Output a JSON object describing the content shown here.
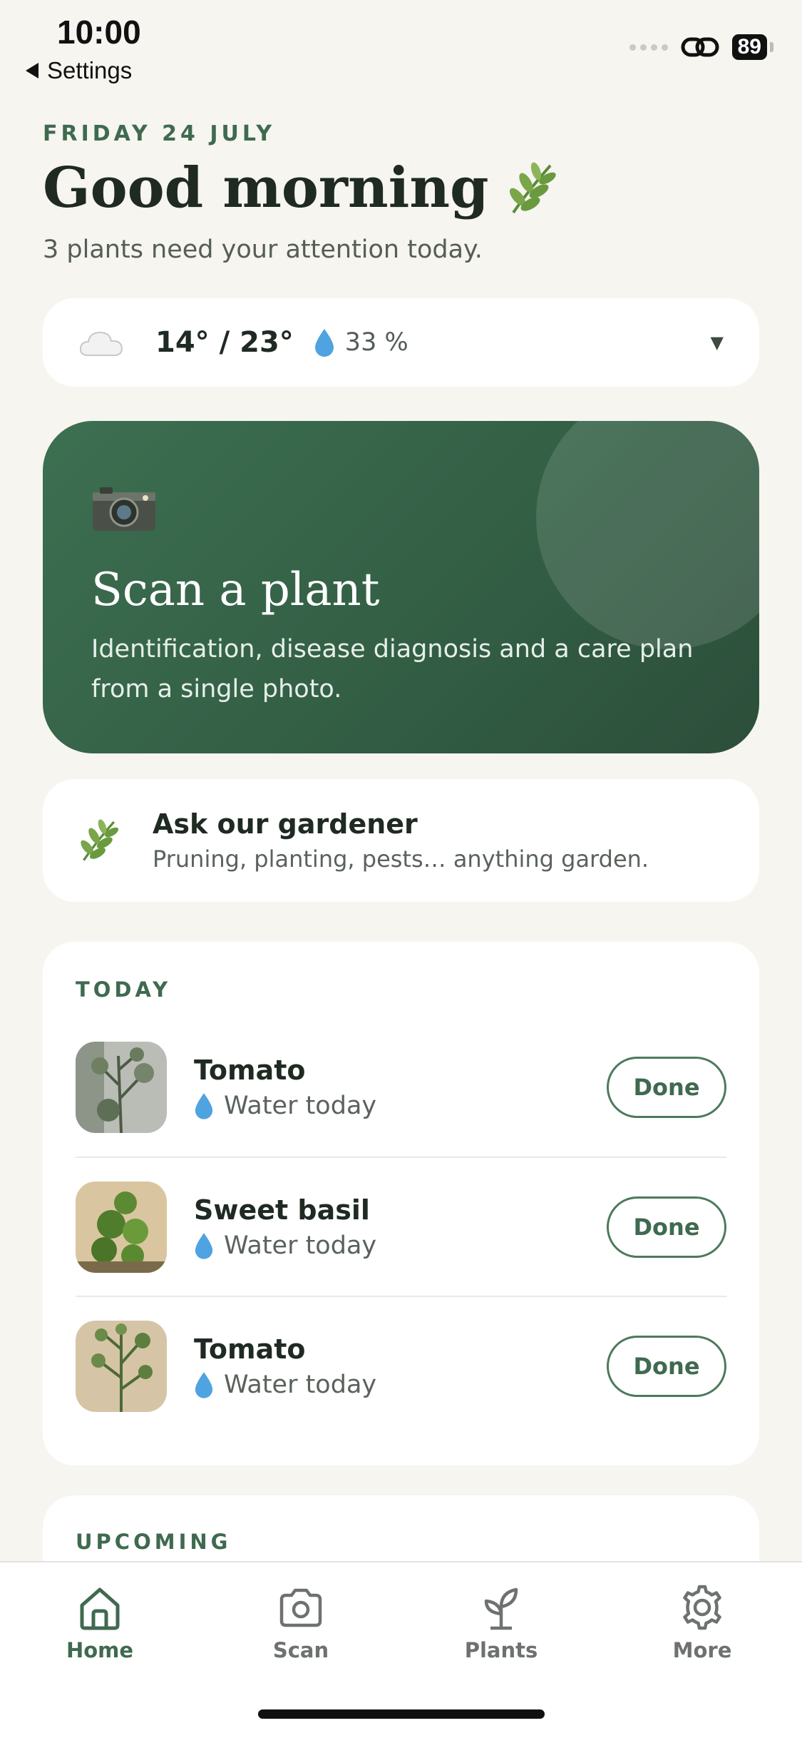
{
  "status_bar": {
    "time": "10:00",
    "back_label": "Settings",
    "battery": "89"
  },
  "header": {
    "date": "FRIDAY 24 JULY",
    "greeting": "Good morning",
    "subtitle": "3 plants need your attention today."
  },
  "weather": {
    "temperature": "14° / 23°",
    "humidity": "33 %",
    "icon": "cloud-icon"
  },
  "scan_card": {
    "title": "Scan a plant",
    "description": "Identification, disease diagnosis and a care plan from a single photo.",
    "icon": "camera-icon"
  },
  "gardener_card": {
    "title": "Ask our gardener",
    "description": "Pruning, planting, pests… anything garden.",
    "icon": "herb-icon"
  },
  "today": {
    "label": "TODAY",
    "tasks": [
      {
        "name": "Tomato",
        "task": "Water today",
        "button": "Done"
      },
      {
        "name": "Sweet basil",
        "task": "Water today",
        "button": "Done"
      },
      {
        "name": "Tomato",
        "task": "Water today",
        "button": "Done"
      }
    ]
  },
  "upcoming": {
    "label": "UPCOMING"
  },
  "tabs": [
    {
      "label": "Home",
      "icon": "home-icon",
      "active": true
    },
    {
      "label": "Scan",
      "icon": "camera-icon",
      "active": false
    },
    {
      "label": "Plants",
      "icon": "sprout-icon",
      "active": false
    },
    {
      "label": "More",
      "icon": "gear-icon",
      "active": false
    }
  ],
  "colors": {
    "accent": "#3f6a4f",
    "background": "#f6f5f0",
    "scan_card": "#335f45"
  }
}
